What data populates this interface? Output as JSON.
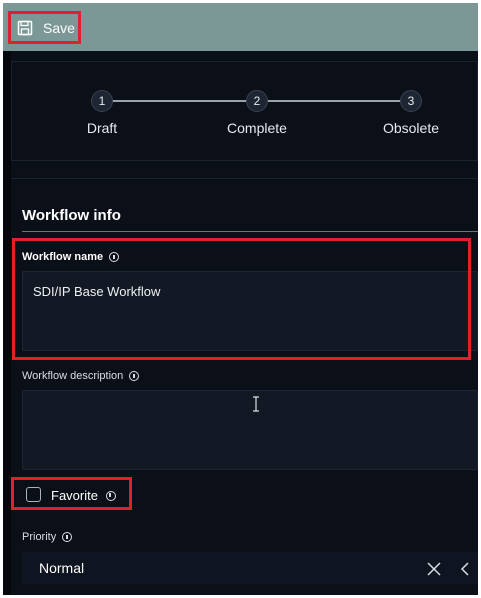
{
  "toolbar": {
    "save_label": "Save"
  },
  "steps": [
    {
      "number": "1",
      "label": "Draft"
    },
    {
      "number": "2",
      "label": "Complete"
    },
    {
      "number": "3",
      "label": "Obsolete"
    }
  ],
  "section": {
    "title": "Workflow info"
  },
  "fields": {
    "name": {
      "label": "Workflow name",
      "value": "SDI/IP Base Workflow"
    },
    "description": {
      "label": "Workflow description",
      "value": ""
    },
    "favorite": {
      "label": "Favorite",
      "checked": false
    },
    "priority": {
      "label": "Priority",
      "value": "Normal"
    }
  },
  "colors": {
    "toolbar_bg": "#7b9896",
    "page_bg": "#0b0f18",
    "highlight": "#e0202a"
  }
}
